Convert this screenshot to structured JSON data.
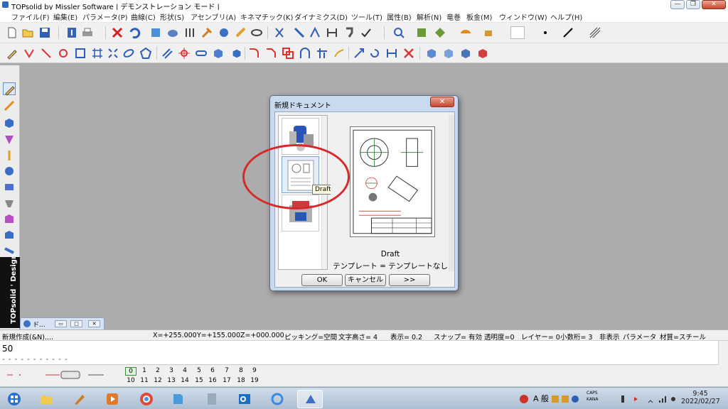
{
  "window": {
    "title": "TOPsolid by Missler Software | デモンストレーション モード |",
    "minimize_glyph": "—",
    "restore_glyph": "❐",
    "close_glyph": "✕"
  },
  "menu": [
    "ファイル(F)",
    "編集(E)",
    "パラメータ(P)",
    "曲線(C)",
    "形状(S)",
    "アセンブリ(A)",
    "キネマチック(K)",
    "ダイナミクス(D)",
    "ツール(T)",
    "属性(B)",
    "解析(N)",
    "竜巻",
    "板金(M)",
    "ウィンドウ(W)",
    "ヘルプ(H)"
  ],
  "left_branding": "TOPsolid ' Design",
  "doc_tab": {
    "label": "ド...",
    "btn1": "▭",
    "btn2": "□",
    "btn3": "✕"
  },
  "status": {
    "command": "新規作成(&N)....",
    "x": "X=+255.000",
    "y": "Y=+155.000",
    "z": "Z=+000.000",
    "picking": "ピッキング=空間",
    "text_height": "文字高さ=   4",
    "display": "表示=   0.2",
    "snap": "スナップ= 有効",
    "transparency": "透明度=0",
    "layer": "レイヤー=   0",
    "decimals": "小数桁= 3",
    "hidden": "非表示",
    "parameters": "パラメータ",
    "material": "材質=スチール"
  },
  "input": {
    "value": "50",
    "dashes": "- - - - - - - - - - -"
  },
  "layers": {
    "row1": [
      "0",
      "1",
      "2",
      "3",
      "4",
      "5",
      "6",
      "7",
      "8",
      "9"
    ],
    "row2": [
      "10",
      "11",
      "12",
      "13",
      "14",
      "15",
      "16",
      "17",
      "18",
      "19"
    ],
    "active": "0"
  },
  "dialog": {
    "title": "新規ドキュメント",
    "close_glyph": "✕",
    "tooltip": "Draft",
    "preview_name": "Draft",
    "template_line": "テンプレート = テンプレートなし",
    "ok": "OK",
    "cancel": "キャンセル",
    "more": ">>"
  },
  "tray": {
    "ime": "A 般",
    "caps": "CAPS",
    "kana": "KANA"
  },
  "clock": {
    "time": "9:45",
    "date": "2022/02/27"
  },
  "colors": {
    "annotation": "#d42a2a",
    "workspace": "#acacac",
    "dialog_frame": "#c9d9ee"
  }
}
